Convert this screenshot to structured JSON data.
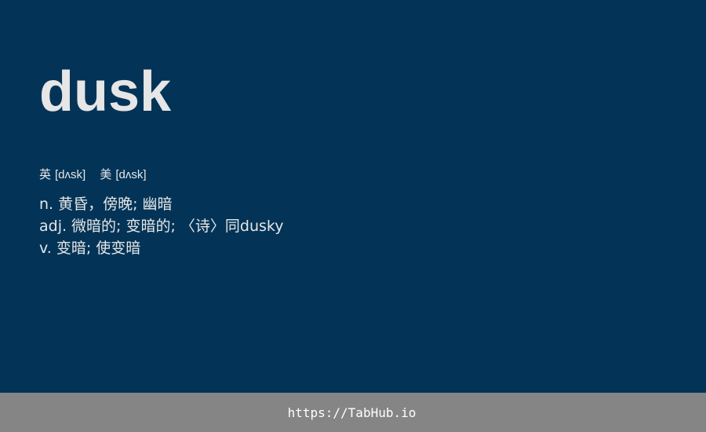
{
  "word": "dusk",
  "phonetics": [
    {
      "label": "英",
      "ipa": "[dʌsk]"
    },
    {
      "label": "美",
      "ipa": "[dʌsk]"
    }
  ],
  "definitions": [
    {
      "pos": "n.",
      "text": "黄昏，傍晚; 幽暗"
    },
    {
      "pos": "adj.",
      "text": "微暗的; 变暗的; 〈诗〉同dusky"
    },
    {
      "pos": "v.",
      "text": "变暗; 使变暗"
    }
  ],
  "footer": {
    "link_text": "https://TabHub.io"
  },
  "colors": {
    "card_background": "#033457",
    "footer_background": "#858585",
    "text": "#e6e6e6"
  }
}
